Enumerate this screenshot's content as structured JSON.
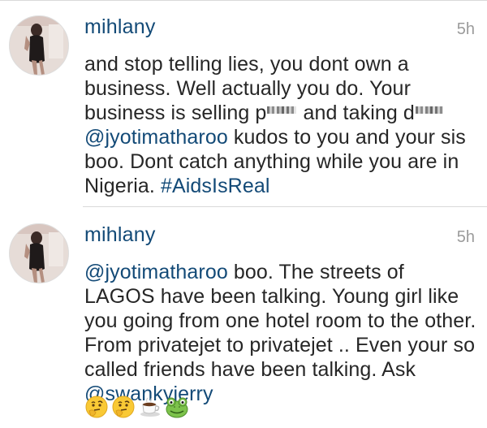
{
  "comments": [
    {
      "username": "mihlany",
      "time": "5h",
      "text": {
        "part1": "and stop telling lies, you dont own a business. Well actually you do. Your business is selling p",
        "part2": " and taking d",
        "part3": " ",
        "mention": "@jyotimatharoo",
        "part4": " kudos to you and your sis boo. Dont catch anything while you are in Nigeria. ",
        "hashtag": "#AidsIsReal"
      }
    },
    {
      "username": "mihlany",
      "time": "5h",
      "text": {
        "mention1": "@jyotimatharoo",
        "part1": " boo. The streets of LAGOS have been talking. Young girl like you going from one hotel room to the other. From privatejet to privatejet .. Even your so called friends have been talking. Ask ",
        "mention2": "@swankyjerry"
      },
      "emojis": [
        "thinking-face",
        "thinking-face",
        "hot-beverage",
        "frog-face"
      ]
    }
  ]
}
